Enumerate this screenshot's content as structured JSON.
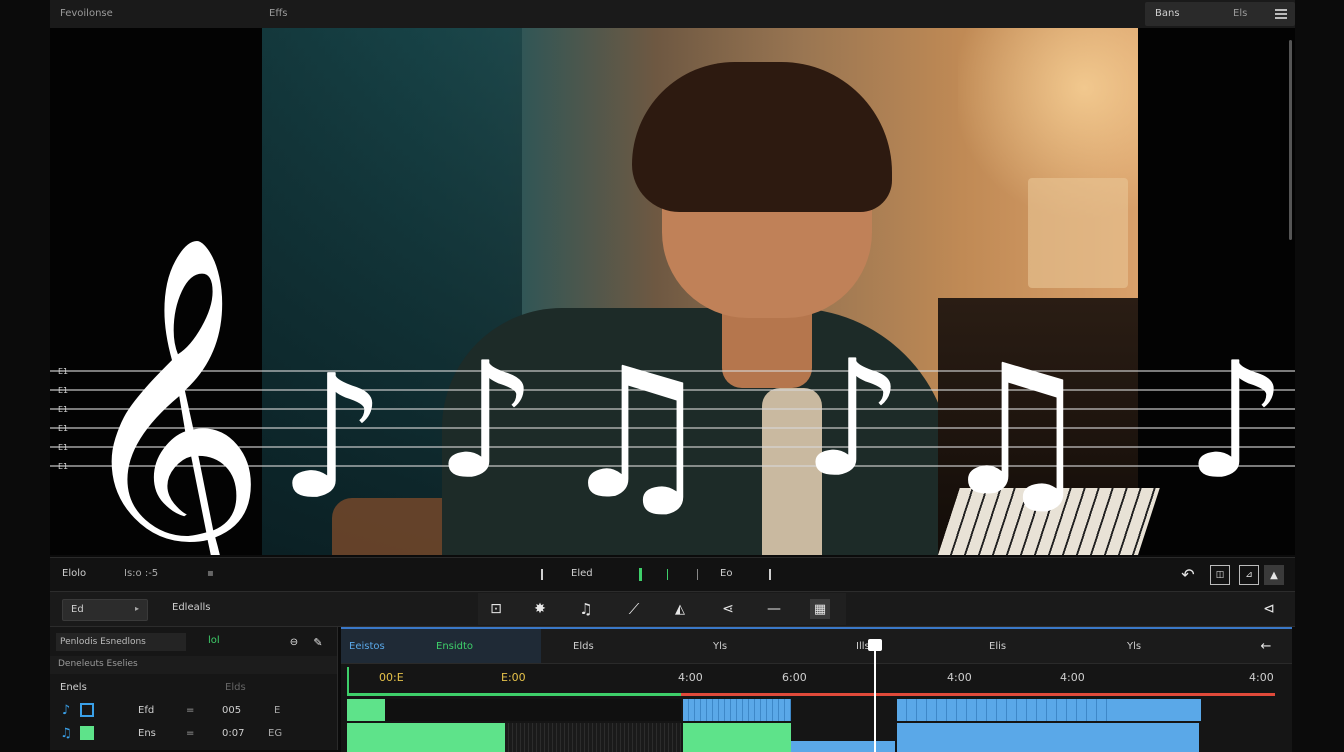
{
  "app": {
    "menu_left": "Fevoilonse",
    "menu_file": "Effs",
    "topright_label": "Bans",
    "topright_right": "Els"
  },
  "overlay": {
    "staff_labels": [
      "E1",
      "E1",
      "E1",
      "E1",
      "E1",
      "E1"
    ],
    "notes": [
      "treble-clef",
      "eighth-note",
      "eighth-note",
      "beamed-notes",
      "eighth-note",
      "beamed-notes",
      "eighth-note"
    ]
  },
  "transport": {
    "left_label": "Elolo",
    "left_label2": "Is:o :-5",
    "center_label": "Eled",
    "center_label2": "Eo",
    "icons": [
      "undo-icon",
      "frame-icon",
      "crop-icon",
      "image-icon"
    ]
  },
  "tools": {
    "dropdown_value": "Ed",
    "label": "Edlealls",
    "tool_icons": [
      "frame-icon",
      "bug-icon",
      "note-icon",
      "slash-icon",
      "film-icon",
      "share-icon",
      "minus-icon",
      "grid-icon"
    ],
    "right_icon": "collapse-icon"
  },
  "left_panel": {
    "row1": "Penlodis Esnedlons",
    "row1_extra": "lol",
    "row2": "Deneleuts Eselies",
    "section": "Enels",
    "section_right": "Elds",
    "tracks": [
      {
        "name": "Efd",
        "sep": "=",
        "value": "005",
        "end": "E"
      },
      {
        "name": "Ens",
        "sep": "=",
        "value": "0:07",
        "end": "EG"
      }
    ]
  },
  "timeline": {
    "tab_active": "Eeistos",
    "tab_green": "Ensidto",
    "ruler_labels": [
      "Elds",
      "Yls",
      "Ills",
      "Elis",
      "Yls"
    ],
    "time_labels": [
      "00:E",
      "E:00",
      "4:00",
      "6:00",
      "4:00",
      "4:00",
      "4:00"
    ],
    "colors": {
      "accent_blue": "#3a78c8",
      "green_clip": "#5ee38a",
      "blue_clip": "#5aa8e8",
      "playhead": "#ffffff",
      "red_bar": "#e04a3a",
      "green_bar": "#3ecf6a"
    }
  }
}
